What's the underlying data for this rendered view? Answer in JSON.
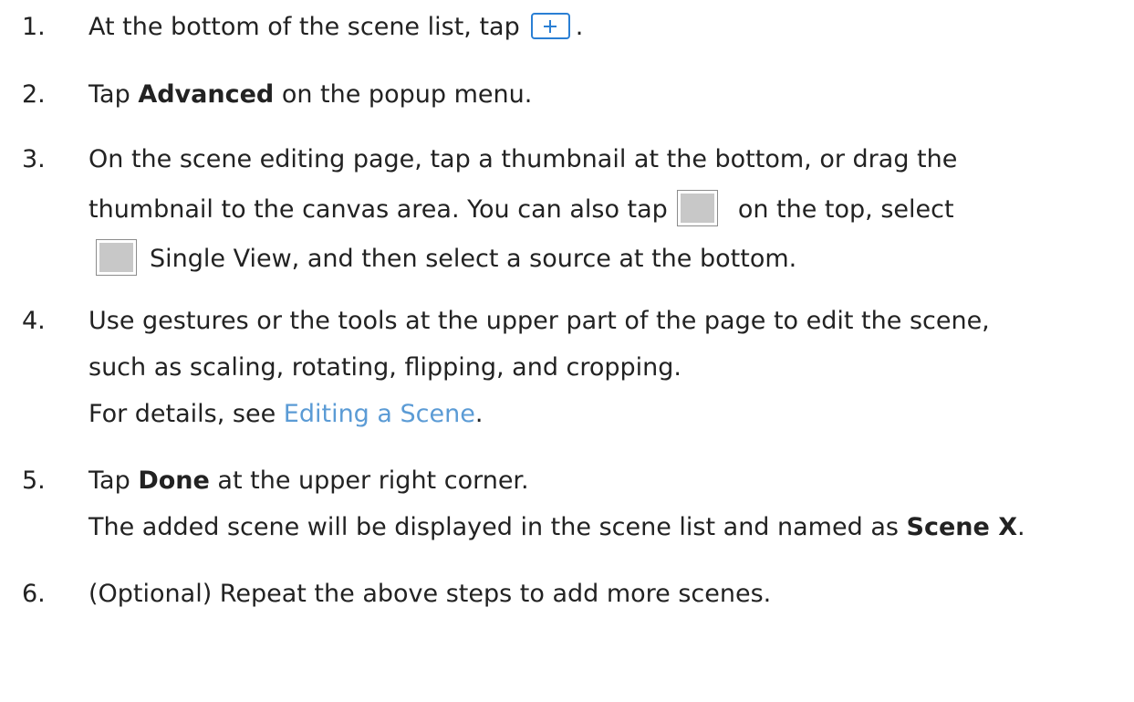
{
  "steps": [
    {
      "num": "1.",
      "text_before": "At the bottom of the scene list, tap",
      "text_after": ".",
      "icon": "plus-icon"
    },
    {
      "num": "2.",
      "text_before": "Tap",
      "bold": "Advanced",
      "text_after": "on the popup menu."
    },
    {
      "num": "3.",
      "line1": "On the scene editing page, tap a thumbnail at the bottom, or drag the",
      "line2_before": "thumbnail to the canvas area. You can also tap",
      "line2_after": "on the top, select",
      "line3_after": "Single View, and then select a source at the bottom.",
      "icon": "single-view-layout-icon"
    },
    {
      "num": "4.",
      "line1": "Use gestures or the tools at the upper part of the page to edit the scene,",
      "line2": "such as scaling, rotating, flipping, and cropping.",
      "line3_before": "For details, see",
      "link": "Editing a Scene",
      "line3_after": "."
    },
    {
      "num": "5.",
      "text_before": "Tap",
      "bold": "Done",
      "text_after": "at the upper right corner.",
      "line2_before": "The added scene will be displayed in the scene list and named as",
      "line2_bold": "Scene X",
      "line2_after": "."
    },
    {
      "num": "6.",
      "text": "(Optional) Repeat the above steps to add more scenes."
    }
  ]
}
